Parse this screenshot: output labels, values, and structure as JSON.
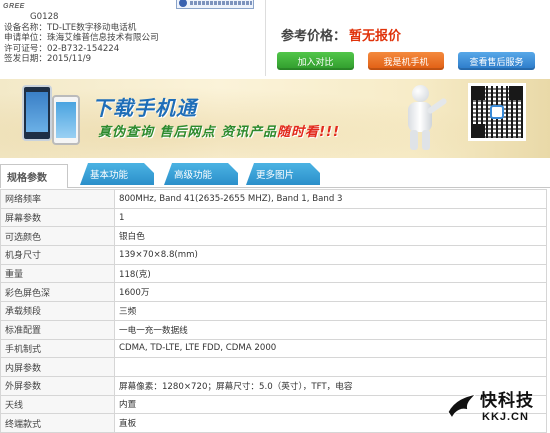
{
  "certificate": {
    "brand": "GREE",
    "model": "G0128",
    "device_name_label": "设备名称：",
    "device_name": "TD-LTE数字移动电话机",
    "applicant_label": "申请单位：",
    "applicant": "珠海艾维普信息技术有限公司",
    "license_label": "许可证号：",
    "license": "02-B732-154224",
    "issue_date_label": "签发日期：",
    "issue_date": "2015/11/9"
  },
  "price": {
    "label": "参考价格：",
    "value": "暂无报价",
    "buttons": [
      "加入对比",
      "我是机手机",
      "查看售后服务"
    ]
  },
  "banner": {
    "title": "下载手机通",
    "subtitle_1": "真伪查询",
    "subtitle_2": "售后网点",
    "subtitle_3": "资讯产品",
    "subtitle_hl": "随时看!!!"
  },
  "tabs": {
    "main": "规格参数",
    "items": [
      "基本功能",
      "高级功能",
      "更多图片"
    ]
  },
  "params": [
    {
      "key": "网络频率",
      "value": "800MHz, Band 41(2635-2655 MHZ), Band 1, Band 3"
    },
    {
      "key": "屏幕参数",
      "value": "1"
    },
    {
      "key": "可选颜色",
      "value": "银白色"
    },
    {
      "key": "机身尺寸",
      "value": "139×70×8.8(mm)"
    },
    {
      "key": "重量",
      "value": "118(克)"
    },
    {
      "key": "彩色屏色深",
      "value": "1600万"
    },
    {
      "key": "承载频段",
      "value": "三频"
    },
    {
      "key": "标准配置",
      "value": "一电一充一数据线"
    },
    {
      "key": "手机制式",
      "value": "CDMA, TD-LTE, LTE FDD, CDMA 2000"
    },
    {
      "key": "内屏参数",
      "value": ""
    },
    {
      "key": "外屏参数",
      "value": "屏幕像素：1280×720；屏幕尺寸：5.0（英寸），TFT，电容"
    },
    {
      "key": "天线",
      "value": "内置"
    },
    {
      "key": "终端款式",
      "value": "直板"
    }
  ],
  "watermark": {
    "name": "快科技",
    "domain": "KKJ.CN"
  },
  "colors": {
    "price_red": "#e0330b",
    "tab_blue": "#2b8fca",
    "btn_green": "#2f9b2c",
    "btn_orange": "#e05d12",
    "btn_blue": "#2a79c8"
  }
}
